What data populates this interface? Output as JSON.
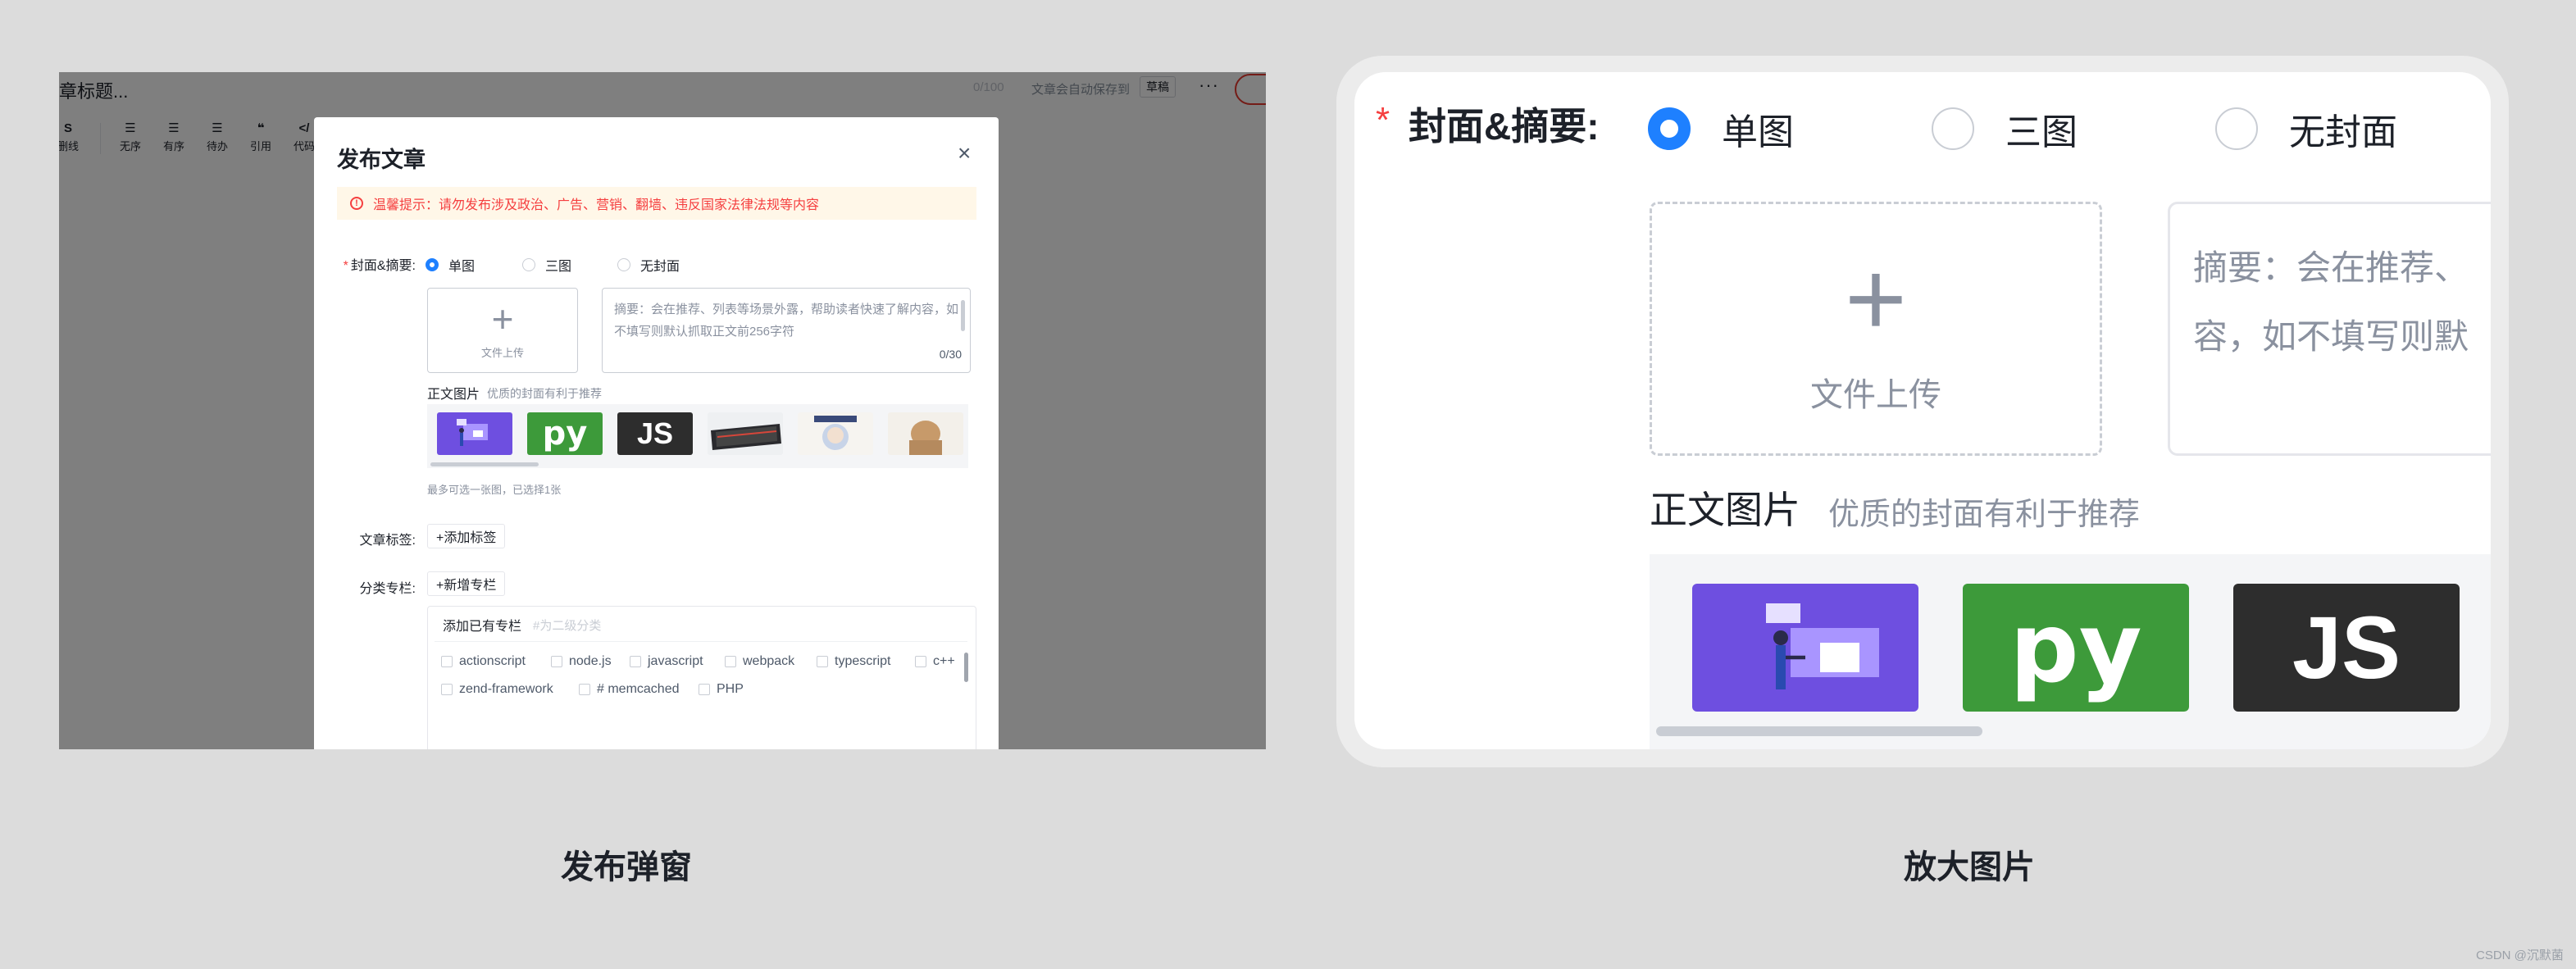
{
  "editor": {
    "title_placeholder": "章标题...",
    "word_count": "0/100",
    "autosave": "文章会自动保存到",
    "draft_button": "草稿",
    "more": "···",
    "toolbar": [
      {
        "glyph": "S",
        "label": "删线"
      },
      {
        "glyph": "☰",
        "label": "无序"
      },
      {
        "glyph": "☰",
        "label": "有序"
      },
      {
        "glyph": "☰",
        "label": "待办"
      },
      {
        "glyph": "❝",
        "label": "引用"
      },
      {
        "glyph": "</",
        "label": "代码"
      }
    ]
  },
  "modal": {
    "title": "发布文章",
    "close": "×",
    "notice": "温馨提示：请勿发布涉及政治、广告、营销、翻墙、违反国家法律法规等内容",
    "cover_label": "封面&摘要:",
    "cover_options": [
      "单图",
      "三图",
      "无封面"
    ],
    "cover_selected": "单图",
    "upload_label": "文件上传",
    "summary_placeholder": "摘要：会在推荐、列表等场景外露，帮助读者快速了解内容，如不填写则默认抓取正文前256字符",
    "summary_count": "0/30",
    "body_images_title": "正文图片",
    "body_images_tip": "优质的封面有利于推荐",
    "pick_tip": "最多可选一张图，已选择1张",
    "tags_label": "文章标签:",
    "add_tag": "+添加标签",
    "column_label": "分类专栏:",
    "add_column": "+新增专栏",
    "column_head": "添加已有专栏",
    "column_head_tip": "#为二级分类",
    "columns": [
      "actionscript",
      "node.js",
      "javascript",
      "webpack",
      "typescript",
      "c++",
      "zend-framework",
      "# memcached",
      "PHP"
    ]
  },
  "zoom": {
    "cover_label": "封面&摘要:",
    "cover_options": [
      "单图",
      "三图",
      "无封面"
    ],
    "upload_label": "文件上传",
    "summary_line1": "摘要：会在推荐、",
    "summary_line2": "容，如不填写则默",
    "body_images_title": "正文图片",
    "body_images_tip": "优质的封面有利于推荐",
    "thumb_py": "py",
    "thumb_js": "JS"
  },
  "captions": {
    "left": "发布弹窗",
    "right": "放大图片"
  },
  "watermark": "CSDN @沉默菌",
  "colors": {
    "accent": "#1e80ff",
    "danger": "#f53f3f",
    "python_green": "#3d9a3a",
    "js_dark": "#2d2d2d",
    "purple": "#6e4fe0"
  }
}
